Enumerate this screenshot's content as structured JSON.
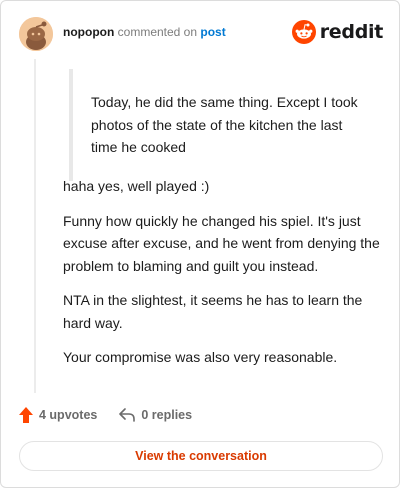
{
  "header": {
    "username": "nopopon",
    "action": "commented on",
    "post_link": "post",
    "brand_name": "reddit"
  },
  "comment": {
    "quote": "Today, he did the same thing. Except I took photos of the state of the kitchen the last time he cooked",
    "paragraphs": [
      "haha yes, well played :)",
      "Funny how quickly he changed his spiel. It's just excuse after excuse, and he went from denying the problem to blaming and guilt you instead.",
      "NTA in the slightest, it seems he has to learn the hard way.",
      "Your compromise was also very reasonable."
    ]
  },
  "footer": {
    "upvotes": "4 upvotes",
    "replies": "0 replies"
  },
  "cta_label": "View the conversation",
  "colors": {
    "brand": "#ff4500",
    "link": "#0079d3",
    "cta": "#d93a00"
  },
  "icons": {
    "avatar": "snoo-avatar",
    "brand": "reddit-logo-icon",
    "upvote": "upvote-arrow-icon",
    "reply": "reply-arrow-icon"
  }
}
